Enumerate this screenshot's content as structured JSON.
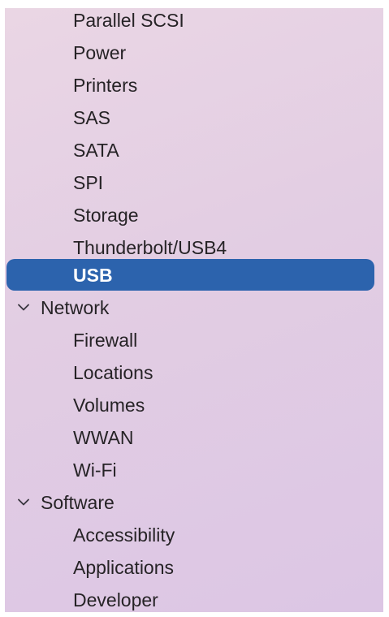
{
  "sidebar": {
    "hardware_items": [
      "Parallel SCSI",
      "Power",
      "Printers",
      "SAS",
      "SATA",
      "SPI",
      "Storage",
      "Thunderbolt/USB4",
      "USB"
    ],
    "selected_item": "USB",
    "network": {
      "label": "Network",
      "expanded": true,
      "items": [
        "Firewall",
        "Locations",
        "Volumes",
        "WWAN",
        "Wi-Fi"
      ]
    },
    "software": {
      "label": "Software",
      "expanded": true,
      "items": [
        "Accessibility",
        "Applications",
        "Developer"
      ]
    },
    "colors": {
      "selection": "#2c63ad",
      "text": "#262326",
      "selected_text": "#ffffff"
    },
    "icons": {
      "disclosure": "chevron-down-icon"
    }
  }
}
